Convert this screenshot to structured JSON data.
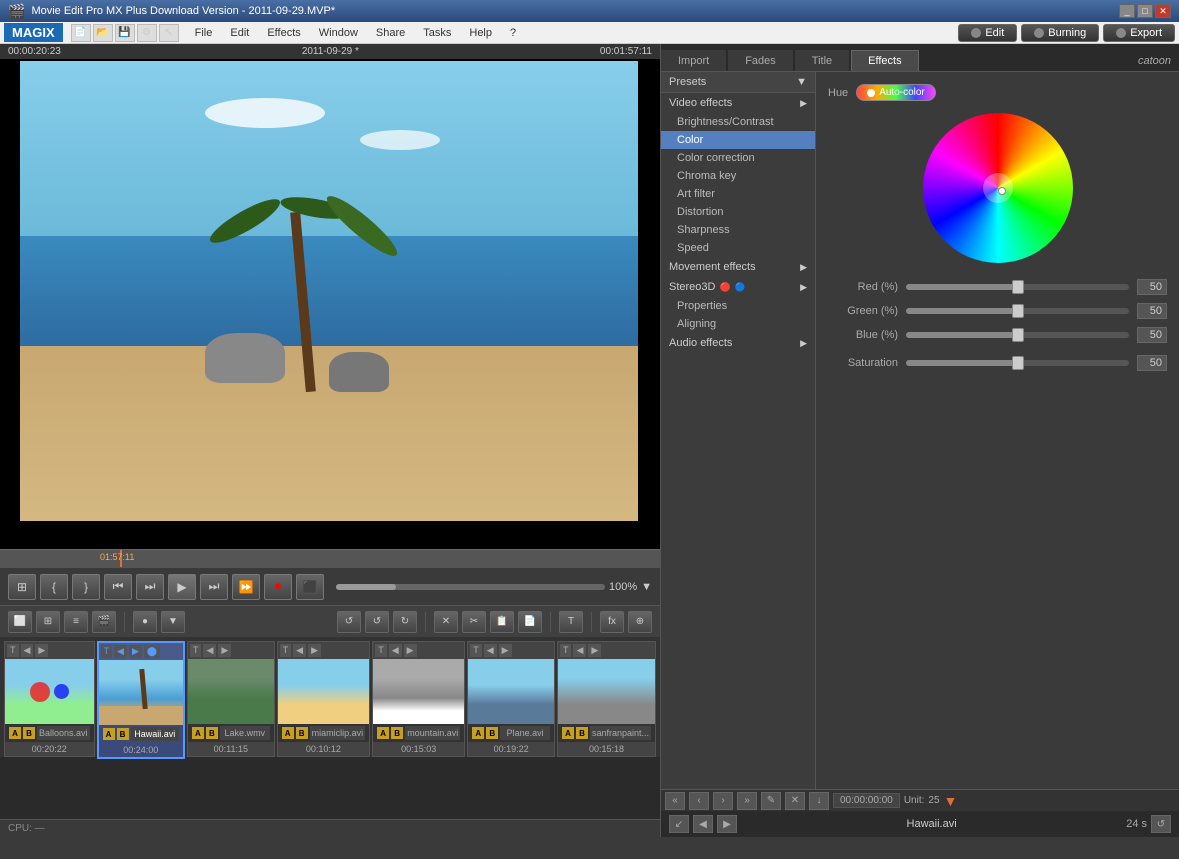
{
  "title": "Movie Edit Pro MX Plus Download Version - 2011-09-29.MVP*",
  "winTitle": "Movie Edit Pro MX Plus Download Version - 2011-09-29.MVP*",
  "menubar": {
    "logo": "MAGIX",
    "menus": [
      "File",
      "Edit",
      "Effects",
      "Window",
      "Share",
      "Tasks",
      "Help"
    ],
    "helpIcon": "?"
  },
  "topButtons": [
    {
      "id": "edit-btn",
      "label": "Edit",
      "dot": "gray"
    },
    {
      "id": "burning-btn",
      "label": "Burning",
      "dot": "gray"
    },
    {
      "id": "export-btn",
      "label": "Export",
      "dot": "gray"
    }
  ],
  "preview": {
    "timecodeLeft": "00:00:20:23",
    "timecodeCenter": "2011-09-29 *",
    "timecodeRight": "00:01:57:11",
    "timelineMarker": "01:57:11"
  },
  "transport": {
    "buttons": [
      "⊞",
      "{",
      "}",
      "⏮",
      "⏭",
      "▶",
      "⏭⏭",
      "⏩",
      "⏺",
      "⬛"
    ],
    "zoom": "100%"
  },
  "rightPanel": {
    "tabs": [
      "Import",
      "Fades",
      "Title",
      "Effects"
    ],
    "activeTab": "Effects",
    "logo": "catoon"
  },
  "effectsList": {
    "presets": "Presets",
    "sections": [
      {
        "label": "Video effects",
        "hasArrow": true,
        "expanded": true
      },
      {
        "label": "Brightness/Contrast",
        "indent": true,
        "selected": false
      },
      {
        "label": "Color",
        "indent": true,
        "selected": true
      },
      {
        "label": "Color correction",
        "indent": true,
        "selected": false
      },
      {
        "label": "Chroma key",
        "indent": true,
        "selected": false
      },
      {
        "label": "Art filter",
        "indent": true,
        "selected": false
      },
      {
        "label": "Distortion",
        "indent": true,
        "selected": false
      },
      {
        "label": "Sharpness",
        "indent": true,
        "selected": false
      },
      {
        "label": "Speed",
        "indent": true,
        "selected": false
      },
      {
        "label": "Movement effects",
        "hasArrow": true,
        "expanded": false
      },
      {
        "label": "Stereo3D",
        "hasArrow": true,
        "expanded": false,
        "hasStereoIcon": true
      },
      {
        "label": "Properties",
        "indent": true,
        "selected": false
      },
      {
        "label": "Aligning",
        "indent": true,
        "selected": false
      },
      {
        "label": "Audio effects",
        "hasArrow": true,
        "expanded": false
      }
    ]
  },
  "colorSettings": {
    "hueLabel": "Hue",
    "autoColorLabel": "Auto-color",
    "sliders": [
      {
        "label": "Red (%)",
        "value": "50",
        "percent": 50
      },
      {
        "label": "Green (%)",
        "value": "50",
        "percent": 50
      },
      {
        "label": "Blue (%)",
        "value": "50",
        "percent": 50
      }
    ],
    "saturation": {
      "label": "Saturation",
      "value": "50",
      "percent": 50
    }
  },
  "timeline": {
    "timecode": "00:00:00:00",
    "unit": "25",
    "clips": [
      {
        "name": "Balloons.avi",
        "duration": "00:20:22",
        "type": "balloons",
        "selected": false
      },
      {
        "name": "Hawaii.avi",
        "duration": "00:24:00",
        "type": "beach",
        "selected": true
      },
      {
        "name": "Lake.wmv",
        "duration": "00:11:15",
        "type": "lake",
        "selected": false
      },
      {
        "name": "miamiclip.avi",
        "duration": "00:10:12",
        "type": "miami",
        "selected": false
      },
      {
        "name": "mountain.avi",
        "duration": "00:15:03",
        "type": "mountain",
        "selected": false
      },
      {
        "name": "Plane.avi",
        "duration": "00:19:22",
        "type": "plane",
        "selected": false
      },
      {
        "name": "sanfranpaint...",
        "duration": "00:15:18",
        "type": "city",
        "selected": false
      }
    ],
    "currentFile": "Hawaii.avi",
    "currentDuration": "24 s"
  },
  "statusBar": {
    "cpu": "CPU: —"
  }
}
